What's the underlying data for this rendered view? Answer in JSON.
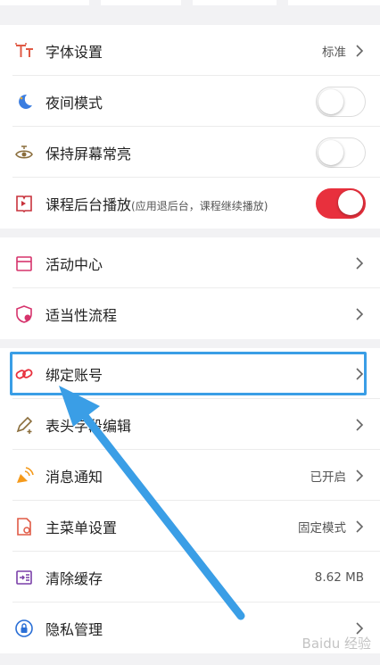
{
  "colors": {
    "accent_red": "#e8303d",
    "highlight_blue": "#3a9ee6",
    "background": "#f2f2f4"
  },
  "group1": [
    {
      "id": "font",
      "icon": "font-size-icon",
      "label": "字体设置",
      "value": "标准",
      "control": "chevron"
    },
    {
      "id": "night",
      "icon": "moon-icon",
      "label": "夜间模式",
      "control": "toggle",
      "on": false
    },
    {
      "id": "screen",
      "icon": "eye-icon",
      "label": "保持屏幕常亮",
      "control": "toggle",
      "on": false
    },
    {
      "id": "bg-play",
      "icon": "book-play-icon",
      "label": "课程后台播放",
      "sublabel": "(应用退后台，课程继续播放)",
      "control": "toggle",
      "on": true
    }
  ],
  "group2": [
    {
      "id": "activity",
      "icon": "calendar-icon",
      "label": "活动中心",
      "control": "chevron"
    },
    {
      "id": "suitability",
      "icon": "shield-icon",
      "label": "适当性流程",
      "control": "chevron"
    }
  ],
  "group3": [
    {
      "id": "bind",
      "icon": "link-icon",
      "label": "绑定账号",
      "control": "chevron"
    },
    {
      "id": "header-edit",
      "icon": "pencil-icon",
      "label": "表头字段编辑",
      "control": "chevron"
    },
    {
      "id": "notify",
      "icon": "megaphone-icon",
      "label": "消息通知",
      "value": "已开启",
      "control": "chevron"
    },
    {
      "id": "menu",
      "icon": "menu-settings-icon",
      "label": "主菜单设置",
      "value": "固定模式",
      "control": "chevron"
    },
    {
      "id": "cache",
      "icon": "clear-cache-icon",
      "label": "清除缓存",
      "value": "8.62 MB",
      "control": "none"
    },
    {
      "id": "privacy",
      "icon": "privacy-lock-icon",
      "label": "隐私管理",
      "control": "chevron"
    }
  ],
  "watermark": "Baidu 经验"
}
